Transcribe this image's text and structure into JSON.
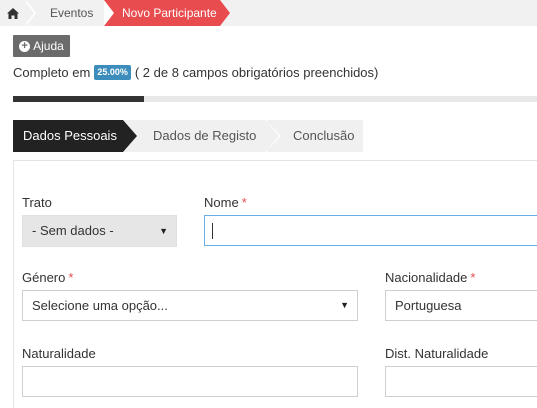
{
  "breadcrumb": {
    "home_icon": "home-icon",
    "items": [
      {
        "label": "Eventos"
      },
      {
        "label": "Novo Participante"
      }
    ]
  },
  "help": {
    "label": "Ajuda",
    "icon": "plus-circle-icon"
  },
  "progress": {
    "prefix": "Completo em",
    "percent_label": "25.00%",
    "percent": 25,
    "detail": "( 2 de 8 campos obrigatórios preenchidos)"
  },
  "steps": [
    {
      "label": "Dados Pessoais",
      "active": true
    },
    {
      "label": "Dados de Registo",
      "active": false
    },
    {
      "label": "Conclusão",
      "active": false
    }
  ],
  "form": {
    "trato": {
      "label": "Trato",
      "value": "- Sem dados -"
    },
    "nome": {
      "label": "Nome",
      "required_mark": "*",
      "value": ""
    },
    "genero": {
      "label": "Género",
      "required_mark": "*",
      "value": "Selecione uma opção..."
    },
    "nacionalidade": {
      "label": "Nacionalidade",
      "required_mark": "*",
      "value": "Portuguesa"
    },
    "naturalidade": {
      "label": "Naturalidade",
      "value": ""
    },
    "dist_naturalidade": {
      "label": "Dist. Naturalidade",
      "value": ""
    }
  },
  "colors": {
    "accent_red": "#e84c4f",
    "badge_blue": "#3c8dbc",
    "active_step": "#222222",
    "focus_border": "#66afe9"
  }
}
